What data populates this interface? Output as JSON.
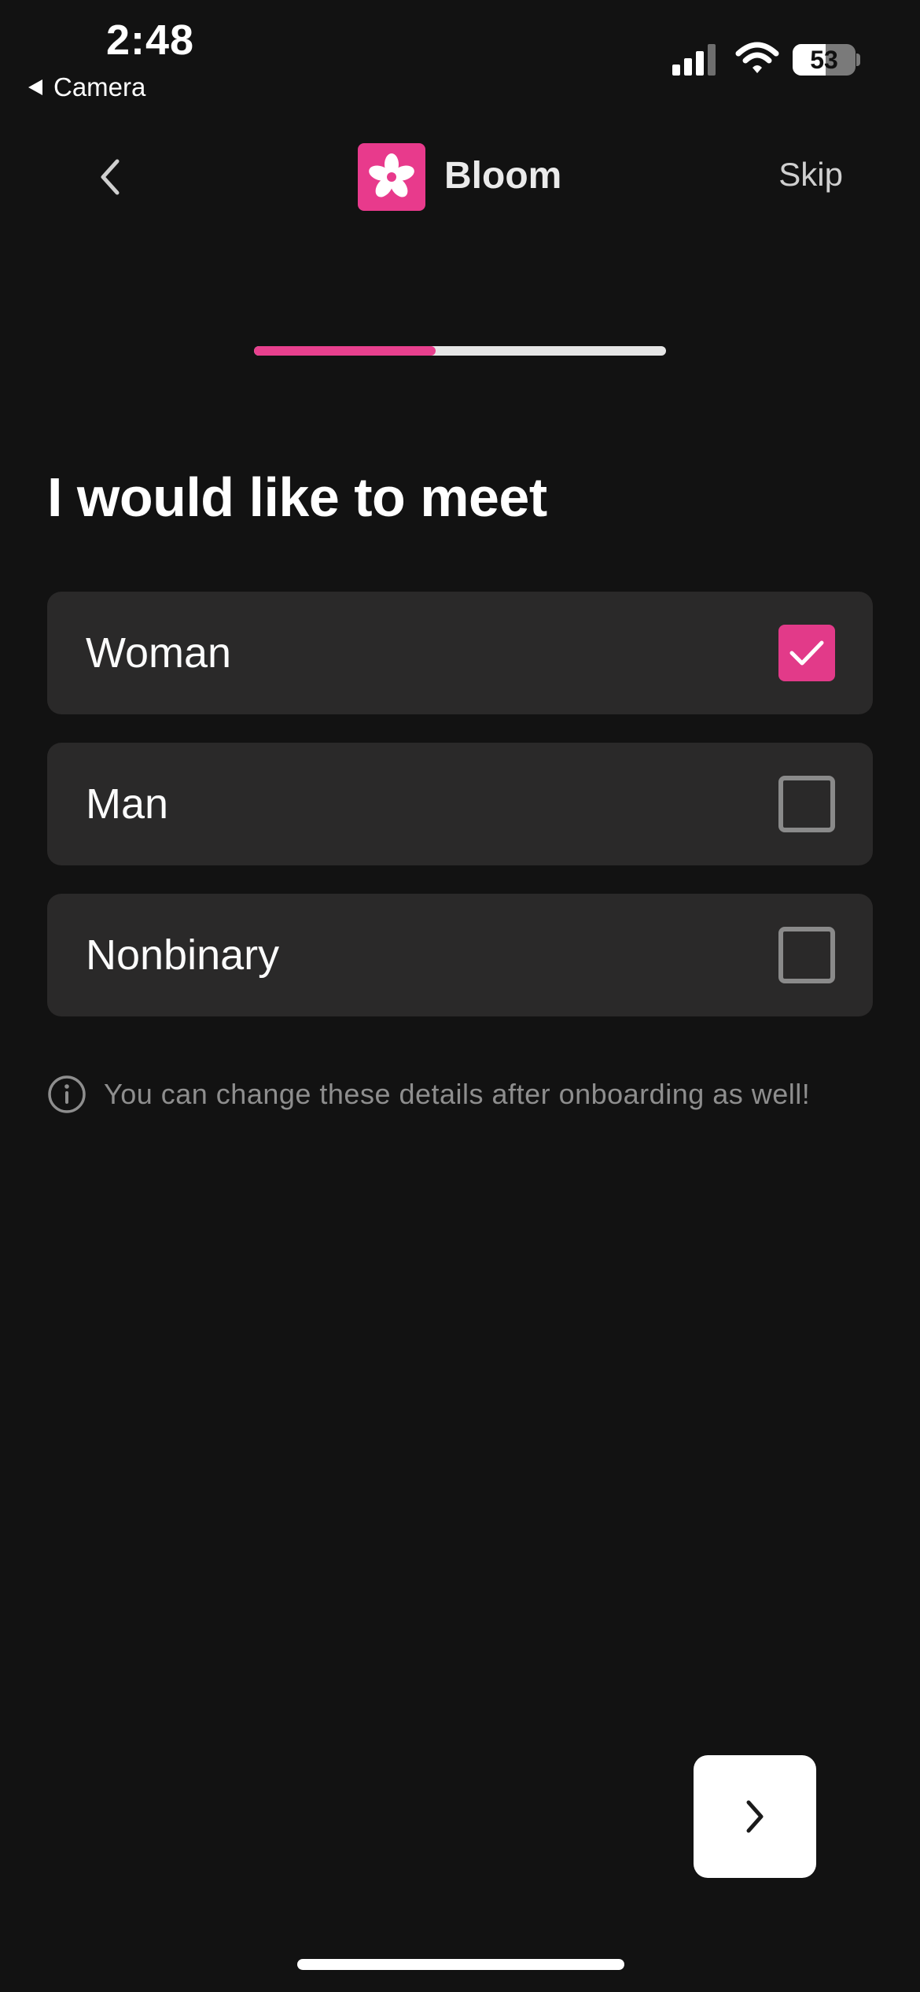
{
  "status_bar": {
    "time": "2:48",
    "back_app_label": "Camera",
    "battery_level": "53",
    "battery_fraction": 0.53,
    "signal_icon": "cellular-signal-icon",
    "wifi_icon": "wifi-icon"
  },
  "header": {
    "back_icon": "chevron-left-icon",
    "logo_icon": "flower-icon",
    "brand_name": "Bloom",
    "skip_label": "Skip"
  },
  "progress": {
    "fraction": 0.44,
    "fill_color": "#e8408e",
    "track_color": "#e6e6e6"
  },
  "main": {
    "title": "I would like to meet",
    "options": [
      {
        "label": "Woman",
        "checked": true
      },
      {
        "label": "Man",
        "checked": false
      },
      {
        "label": "Nonbinary",
        "checked": false
      }
    ],
    "info_icon": "info-circle-icon",
    "info_text": "You can change these details after onboarding as well!"
  },
  "footer": {
    "next_icon": "chevron-right-icon"
  },
  "colors": {
    "background": "#121212",
    "card": "#2a2929",
    "accent": "#e23a89"
  }
}
